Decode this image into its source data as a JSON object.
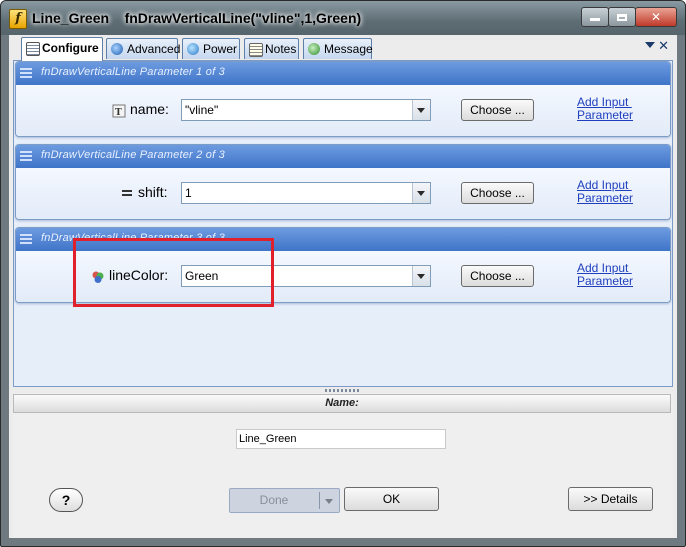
{
  "window": {
    "title_name": "Line_Green",
    "title_function": "fnDrawVerticalLine(\"vline\",1,Green)",
    "app_icon_glyph": "f",
    "controls": [
      "minimize-icon",
      "maximize-icon",
      "close-icon"
    ]
  },
  "tabs": [
    {
      "label": "Configure",
      "icon": "configure-icon",
      "active": true
    },
    {
      "label": "Advanced",
      "icon": "advanced-icon",
      "active": false
    },
    {
      "label": "Power",
      "icon": "power-icon",
      "active": false
    },
    {
      "label": "Notes",
      "icon": "notes-icon",
      "active": false
    },
    {
      "label": "Message",
      "icon": "message-icon",
      "active": false
    }
  ],
  "tabstrip_close": "✕",
  "params": [
    {
      "header": "fnDrawVerticalLine Parameter 1 of 3",
      "label": "name:",
      "value": "\"vline\"",
      "icon": "text-type-icon",
      "choose": "Choose ...",
      "link": "Add Input \nParameter"
    },
    {
      "header": "fnDrawVerticalLine Parameter 2 of 3",
      "label": "shift:",
      "value": "1",
      "icon": "number-type-icon",
      "choose": "Choose ...",
      "link": "Add Input \nParameter"
    },
    {
      "header": "fnDrawVerticalLine Parameter 3 of 3",
      "label": "lineColor:",
      "value": "Green",
      "icon": "color-type-icon",
      "choose": "Choose ...",
      "link": "Add Input \nParameter"
    }
  ],
  "name_section": {
    "header": "Name:",
    "value": "Line_Green"
  },
  "buttons": {
    "help": "?",
    "done": "Done",
    "ok": "OK",
    "details": ">> Details"
  },
  "colors": {
    "group_header": "#3f74c8",
    "link": "#1f3fbf",
    "highlight": "#e0202a"
  }
}
